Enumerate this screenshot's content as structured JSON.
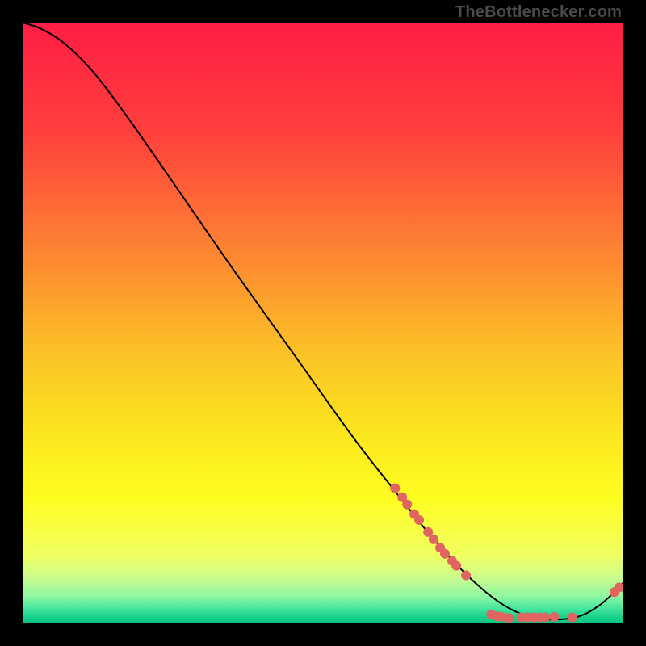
{
  "watermark": "TheBottleneсker.com",
  "chart_data": {
    "type": "line",
    "title": "",
    "xlabel": "",
    "ylabel": "",
    "xlim": [
      0,
      100
    ],
    "ylim": [
      0,
      100
    ],
    "grid": false,
    "legend": false,
    "line_color": "#000000",
    "point_color": "#e0645f",
    "gradient_stops": [
      {
        "pos": 0.0,
        "color": "#ff1d44"
      },
      {
        "pos": 0.18,
        "color": "#ff3f3d"
      },
      {
        "pos": 0.38,
        "color": "#fd8432"
      },
      {
        "pos": 0.55,
        "color": "#fbc227"
      },
      {
        "pos": 0.68,
        "color": "#fbe51e"
      },
      {
        "pos": 0.79,
        "color": "#fefd1f"
      },
      {
        "pos": 0.885,
        "color": "#f2ff60"
      },
      {
        "pos": 0.925,
        "color": "#c9fd8f"
      },
      {
        "pos": 0.955,
        "color": "#8ef7a2"
      },
      {
        "pos": 0.975,
        "color": "#46e69d"
      },
      {
        "pos": 0.99,
        "color": "#16d18b"
      },
      {
        "pos": 1.0,
        "color": "#0bc183"
      }
    ],
    "curve": [
      {
        "x": 0.0,
        "y": 100.0
      },
      {
        "x": 3.0,
        "y": 99.0
      },
      {
        "x": 7.0,
        "y": 96.5
      },
      {
        "x": 12.0,
        "y": 91.5
      },
      {
        "x": 18.0,
        "y": 83.5
      },
      {
        "x": 26.0,
        "y": 72.0
      },
      {
        "x": 35.0,
        "y": 59.0
      },
      {
        "x": 45.0,
        "y": 45.0
      },
      {
        "x": 55.0,
        "y": 31.0
      },
      {
        "x": 62.0,
        "y": 22.0
      },
      {
        "x": 68.0,
        "y": 14.5
      },
      {
        "x": 73.0,
        "y": 9.0
      },
      {
        "x": 78.0,
        "y": 4.5
      },
      {
        "x": 82.0,
        "y": 2.0
      },
      {
        "x": 86.0,
        "y": 0.8
      },
      {
        "x": 90.0,
        "y": 0.7
      },
      {
        "x": 93.0,
        "y": 1.3
      },
      {
        "x": 96.0,
        "y": 3.0
      },
      {
        "x": 98.5,
        "y": 5.2
      },
      {
        "x": 100.0,
        "y": 6.8
      }
    ],
    "points": [
      {
        "x": 62.0,
        "y": 22.5
      },
      {
        "x": 63.2,
        "y": 21.0
      },
      {
        "x": 64.0,
        "y": 19.8
      },
      {
        "x": 65.2,
        "y": 18.2
      },
      {
        "x": 66.0,
        "y": 17.2
      },
      {
        "x": 67.5,
        "y": 15.2
      },
      {
        "x": 68.4,
        "y": 14.0
      },
      {
        "x": 69.5,
        "y": 12.6
      },
      {
        "x": 70.3,
        "y": 11.6
      },
      {
        "x": 71.5,
        "y": 10.4
      },
      {
        "x": 72.2,
        "y": 9.6
      },
      {
        "x": 73.8,
        "y": 8.0
      },
      {
        "x": 78.0,
        "y": 1.5
      },
      {
        "x": 79.0,
        "y": 1.2
      },
      {
        "x": 79.8,
        "y": 1.1
      },
      {
        "x": 81.0,
        "y": 0.9
      },
      {
        "x": 83.0,
        "y": 1.0
      },
      {
        "x": 84.0,
        "y": 1.0
      },
      {
        "x": 85.0,
        "y": 1.0
      },
      {
        "x": 86.0,
        "y": 1.0
      },
      {
        "x": 87.0,
        "y": 1.0
      },
      {
        "x": 88.5,
        "y": 1.1
      },
      {
        "x": 91.5,
        "y": 1.0
      },
      {
        "x": 98.5,
        "y": 5.2
      },
      {
        "x": 99.3,
        "y": 6.0
      }
    ]
  }
}
